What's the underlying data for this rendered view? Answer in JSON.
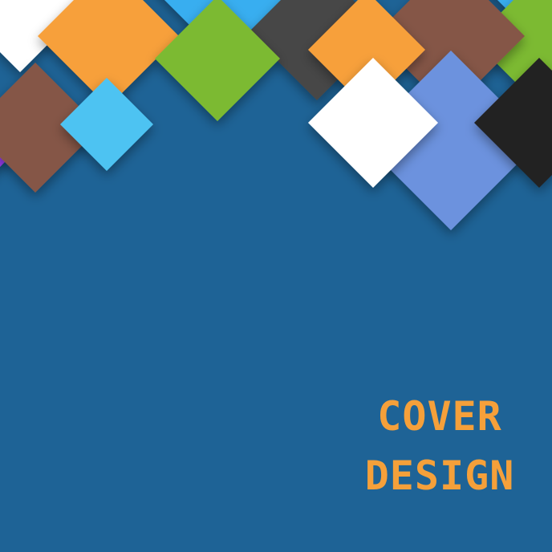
{
  "background_color": "#1e6396",
  "title": {
    "line1": "COVER",
    "line2": "DESIGN",
    "color": "#f5a03a"
  },
  "palette": {
    "sky_blue": "#38aef0",
    "white": "#ffffff",
    "dark_gray": "#474747",
    "orange": "#f7a03a",
    "green": "#7cba32",
    "brown": "#855646",
    "purple": "#9b3cf0",
    "light_blue": "#4ec3f2",
    "periwinkle": "#6c92de",
    "black": "#222222"
  }
}
